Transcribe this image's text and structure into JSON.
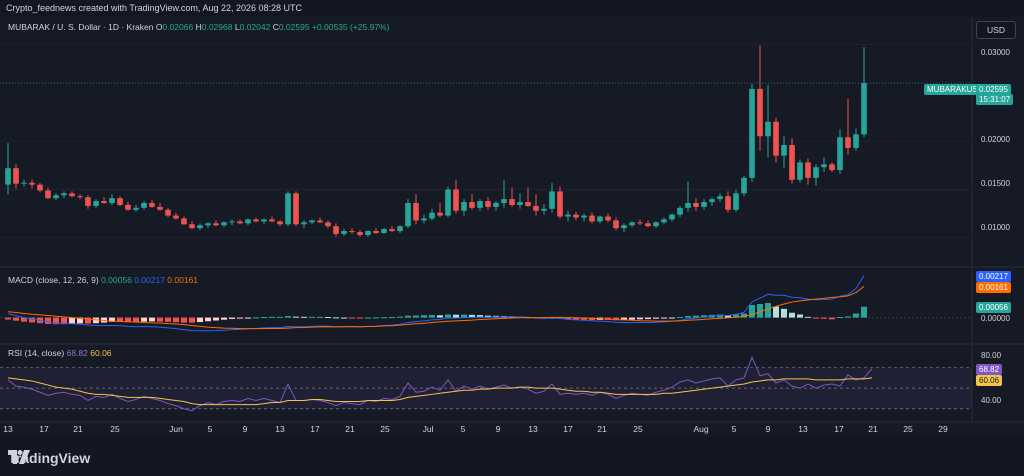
{
  "header": {
    "caption": "Crypto_feednews created with TradingView.com, Aug 22, 2026 08:28 UTC"
  },
  "symbol": {
    "title": "MUBARAK / U. S. Dollar · 1D · Kraken",
    "o_label": "O",
    "o": "0.02066",
    "h_label": "H",
    "h": "0.02968",
    "l_label": "L",
    "l": "0.02042",
    "c_label": "C",
    "c": "0.02595",
    "change": "+0.00535 (+25.97%)"
  },
  "currency_button": "USD",
  "price_axis": [
    "0.03000",
    "0.02000",
    "0.01500",
    "0.01000"
  ],
  "last_price": {
    "ticker": "MUBARAKUSD",
    "price": "0.02595",
    "countdown": "15:31:07"
  },
  "macd": {
    "title": "MACD (close, 12, 26, 9)",
    "hist": "0.00056",
    "macd": "0.00217",
    "signal": "0.00161",
    "zero": "0.00000"
  },
  "rsi": {
    "title": "RSI (14, close)",
    "rsi": "68.82",
    "ma": "60.06",
    "upper": "80.00",
    "lower": "40.00"
  },
  "time_axis": [
    "13",
    "17",
    "21",
    "25",
    "Jun",
    "5",
    "9",
    "13",
    "17",
    "21",
    "25",
    "Jul",
    "5",
    "9",
    "13",
    "17",
    "21",
    "25",
    "Aug",
    "5",
    "9",
    "13",
    "17",
    "21",
    "25",
    "29"
  ],
  "colors": {
    "up": "#26a69a",
    "down": "#ef5350",
    "macd": "#2962ff",
    "signal": "#ff6d00",
    "rsi": "#7e57c2",
    "rsi_ma": "#f3c44a"
  },
  "brand": "TradingView",
  "chart_data": {
    "type": "candlestick",
    "interval": "1D",
    "x_start": "2025-05-13",
    "price_ylim": [
      0.0075,
      0.0318
    ],
    "candles": [
      [
        0.0155,
        0.0198,
        0.0145,
        0.0172
      ],
      [
        0.0172,
        0.0176,
        0.0151,
        0.0156
      ],
      [
        0.0156,
        0.016,
        0.0153,
        0.0157
      ],
      [
        0.0157,
        0.016,
        0.0151,
        0.0155
      ],
      [
        0.0155,
        0.0157,
        0.0147,
        0.0149
      ],
      [
        0.0149,
        0.0152,
        0.014,
        0.0141
      ],
      [
        0.0141,
        0.0146,
        0.0139,
        0.0144
      ],
      [
        0.0144,
        0.0148,
        0.0141,
        0.0146
      ],
      [
        0.0146,
        0.0148,
        0.0142,
        0.0143
      ],
      [
        0.0143,
        0.0145,
        0.014,
        0.0142
      ],
      [
        0.0142,
        0.0144,
        0.013,
        0.0133
      ],
      [
        0.0133,
        0.014,
        0.0131,
        0.0138
      ],
      [
        0.0138,
        0.0142,
        0.0135,
        0.0136
      ],
      [
        0.0136,
        0.0145,
        0.0134,
        0.0141
      ],
      [
        0.0141,
        0.0143,
        0.0133,
        0.0134
      ],
      [
        0.0134,
        0.0137,
        0.0128,
        0.0129
      ],
      [
        0.0129,
        0.0134,
        0.0127,
        0.0131
      ],
      [
        0.0131,
        0.0138,
        0.0129,
        0.0136
      ],
      [
        0.0136,
        0.0139,
        0.0131,
        0.0132
      ],
      [
        0.0132,
        0.0136,
        0.0128,
        0.0129
      ],
      [
        0.0129,
        0.0131,
        0.0121,
        0.0123
      ],
      [
        0.0123,
        0.0126,
        0.0119,
        0.012
      ],
      [
        0.012,
        0.0122,
        0.0113,
        0.0114
      ],
      [
        0.0114,
        0.0117,
        0.0109,
        0.011
      ],
      [
        0.011,
        0.0115,
        0.0108,
        0.0113
      ],
      [
        0.0113,
        0.0116,
        0.011,
        0.0115
      ],
      [
        0.0115,
        0.0118,
        0.0112,
        0.0113
      ],
      [
        0.0113,
        0.0117,
        0.0111,
        0.0116
      ],
      [
        0.0116,
        0.0119,
        0.0113,
        0.0117
      ],
      [
        0.0117,
        0.0119,
        0.0114,
        0.0115
      ],
      [
        0.0115,
        0.012,
        0.0113,
        0.0119
      ],
      [
        0.0119,
        0.0121,
        0.0116,
        0.0117
      ],
      [
        0.0117,
        0.012,
        0.0114,
        0.0119
      ],
      [
        0.0119,
        0.0122,
        0.0116,
        0.0117
      ],
      [
        0.0117,
        0.0118,
        0.0112,
        0.0114
      ],
      [
        0.0114,
        0.0148,
        0.0112,
        0.0146
      ],
      [
        0.0146,
        0.0148,
        0.0112,
        0.0114
      ],
      [
        0.0114,
        0.0118,
        0.011,
        0.0116
      ],
      [
        0.0116,
        0.0119,
        0.0114,
        0.0118
      ],
      [
        0.0118,
        0.0121,
        0.0115,
        0.0116
      ],
      [
        0.0116,
        0.0118,
        0.011,
        0.0112
      ],
      [
        0.0112,
        0.0115,
        0.0101,
        0.0104
      ],
      [
        0.0104,
        0.0109,
        0.0102,
        0.0107
      ],
      [
        0.0107,
        0.011,
        0.0104,
        0.0106
      ],
      [
        0.0106,
        0.0108,
        0.0101,
        0.0103
      ],
      [
        0.0103,
        0.0108,
        0.0101,
        0.0107
      ],
      [
        0.0107,
        0.011,
        0.0104,
        0.0105
      ],
      [
        0.0105,
        0.011,
        0.0104,
        0.0109
      ],
      [
        0.0109,
        0.0112,
        0.0106,
        0.0107
      ],
      [
        0.0107,
        0.0113,
        0.0105,
        0.0112
      ],
      [
        0.0112,
        0.014,
        0.011,
        0.0136
      ],
      [
        0.0136,
        0.0145,
        0.0114,
        0.0118
      ],
      [
        0.0118,
        0.0124,
        0.0115,
        0.012
      ],
      [
        0.012,
        0.013,
        0.0118,
        0.0126
      ],
      [
        0.0126,
        0.0136,
        0.0121,
        0.0123
      ],
      [
        0.0123,
        0.0153,
        0.0121,
        0.015
      ],
      [
        0.015,
        0.016,
        0.0125,
        0.0128
      ],
      [
        0.0128,
        0.014,
        0.0123,
        0.0137
      ],
      [
        0.0137,
        0.0145,
        0.0129,
        0.0131
      ],
      [
        0.0131,
        0.014,
        0.0128,
        0.0138
      ],
      [
        0.0138,
        0.0142,
        0.0129,
        0.0132
      ],
      [
        0.0132,
        0.0138,
        0.0128,
        0.0136
      ],
      [
        0.0136,
        0.016,
        0.0131,
        0.014
      ],
      [
        0.014,
        0.0152,
        0.0132,
        0.0134
      ],
      [
        0.0134,
        0.0146,
        0.013,
        0.0137
      ],
      [
        0.0137,
        0.0152,
        0.0132,
        0.0133
      ],
      [
        0.0133,
        0.0145,
        0.0123,
        0.0128
      ],
      [
        0.0128,
        0.0135,
        0.0124,
        0.013
      ],
      [
        0.013,
        0.0157,
        0.0126,
        0.0148
      ],
      [
        0.0148,
        0.0153,
        0.012,
        0.0122
      ],
      [
        0.0122,
        0.0128,
        0.0117,
        0.0124
      ],
      [
        0.0124,
        0.0127,
        0.0118,
        0.0121
      ],
      [
        0.0121,
        0.0125,
        0.0117,
        0.0123
      ],
      [
        0.0123,
        0.0126,
        0.0115,
        0.0117
      ],
      [
        0.0117,
        0.0123,
        0.0115,
        0.0122
      ],
      [
        0.0122,
        0.0125,
        0.0116,
        0.0118
      ],
      [
        0.0118,
        0.0121,
        0.0108,
        0.011
      ],
      [
        0.011,
        0.0115,
        0.0106,
        0.0113
      ],
      [
        0.0113,
        0.0117,
        0.0111,
        0.0116
      ],
      [
        0.0116,
        0.0119,
        0.0113,
        0.0115
      ],
      [
        0.0115,
        0.0118,
        0.0111,
        0.0112
      ],
      [
        0.0112,
        0.0117,
        0.011,
        0.0116
      ],
      [
        0.0116,
        0.0121,
        0.0114,
        0.0119
      ],
      [
        0.0119,
        0.0125,
        0.0117,
        0.0124
      ],
      [
        0.0124,
        0.0133,
        0.0121,
        0.0131
      ],
      [
        0.0131,
        0.0158,
        0.0127,
        0.0136
      ],
      [
        0.0136,
        0.0141,
        0.0128,
        0.0132
      ],
      [
        0.0132,
        0.014,
        0.0129,
        0.0137
      ],
      [
        0.0137,
        0.0142,
        0.0133,
        0.014
      ],
      [
        0.014,
        0.0146,
        0.0137,
        0.0143
      ],
      [
        0.0143,
        0.0148,
        0.0126,
        0.0129
      ],
      [
        0.0129,
        0.015,
        0.0127,
        0.0146
      ],
      [
        0.0146,
        0.0164,
        0.0143,
        0.0162
      ],
      [
        0.0162,
        0.0259,
        0.0158,
        0.0254
      ],
      [
        0.0254,
        0.0299,
        0.019,
        0.0205
      ],
      [
        0.0205,
        0.0258,
        0.0183,
        0.022
      ],
      [
        0.022,
        0.0224,
        0.0178,
        0.0185
      ],
      [
        0.0185,
        0.0205,
        0.0172,
        0.0196
      ],
      [
        0.0196,
        0.0203,
        0.0156,
        0.016
      ],
      [
        0.016,
        0.0181,
        0.0157,
        0.0178
      ],
      [
        0.0178,
        0.0182,
        0.0155,
        0.0162
      ],
      [
        0.0162,
        0.0176,
        0.0154,
        0.0173
      ],
      [
        0.0173,
        0.0183,
        0.0168,
        0.0176
      ],
      [
        0.0176,
        0.0178,
        0.0168,
        0.017
      ],
      [
        0.017,
        0.0212,
        0.0166,
        0.0204
      ],
      [
        0.0204,
        0.0244,
        0.0186,
        0.0193
      ],
      [
        0.0193,
        0.0213,
        0.019,
        0.0207
      ],
      [
        0.0207,
        0.0297,
        0.0204,
        0.026
      ]
    ],
    "macd_ylim": [
      -0.001,
      0.0024
    ],
    "macd_hist": [
      -0.0001,
      -0.00016,
      -0.00021,
      -0.00025,
      -0.00029,
      -0.00033,
      -0.00034,
      -0.00034,
      -0.00032,
      -0.0003,
      -0.00031,
      -0.00029,
      -0.00026,
      -0.00022,
      -0.00022,
      -0.00024,
      -0.00024,
      -0.00021,
      -0.0002,
      -0.00021,
      -0.00022,
      -0.00024,
      -0.00026,
      -0.00026,
      -0.00023,
      -0.00019,
      -0.00015,
      -0.00011,
      -7e-05,
      -4e-05,
      -1e-05,
      1e-05,
      3e-05,
      4e-05,
      4e-05,
      8e-05,
      5e-05,
      4e-05,
      4e-05,
      4e-05,
      3e-05,
      1e-05,
      0.0,
      -1e-05,
      -1e-05,
      0.0,
      1e-05,
      2e-05,
      3e-05,
      5e-05,
      0.0001,
      0.00011,
      0.00012,
      0.00013,
      0.00012,
      0.00016,
      0.00015,
      0.00015,
      0.00014,
      0.00013,
      0.0001,
      9e-05,
      8e-05,
      6e-05,
      4e-05,
      2e-05,
      -2e-05,
      -5e-05,
      -2e-05,
      -6e-05,
      -9e-05,
      -0.00011,
      -0.00012,
      -0.00013,
      -0.00012,
      -0.00012,
      -0.00014,
      -0.00013,
      -0.00011,
      -9e-05,
      -8e-05,
      -6e-05,
      -4e-05,
      -1e-05,
      3e-05,
      8e-05,
      0.0001,
      0.00012,
      0.00014,
      0.00016,
      0.00012,
      0.00015,
      0.00021,
      0.00065,
      0.0007,
      0.00075,
      0.00057,
      0.00045,
      0.00025,
      0.00016,
      4e-05,
      -3e-05,
      -6e-05,
      -9e-05,
      3e-05,
      6e-05,
      0.00021,
      0.00056
    ],
    "macd_line": [
      0.0002,
      0.0001,
      0.0,
      -8e-05,
      -0.00015,
      -0.00022,
      -0.00027,
      -0.0003,
      -0.00032,
      -0.00034,
      -0.00038,
      -0.0004,
      -0.00041,
      -0.00041,
      -0.00042,
      -0.00045,
      -0.00047,
      -0.00046,
      -0.00047,
      -0.00049,
      -0.00053,
      -0.00057,
      -0.00062,
      -0.00067,
      -0.00068,
      -0.00068,
      -0.00067,
      -0.00065,
      -0.00062,
      -0.00061,
      -0.00058,
      -0.00056,
      -0.00053,
      -0.00052,
      -0.00052,
      -0.00046,
      -0.00047,
      -0.00047,
      -0.00045,
      -0.00044,
      -0.00044,
      -0.00047,
      -0.00047,
      -0.00047,
      -0.00048,
      -0.00046,
      -0.00044,
      -0.00041,
      -0.00039,
      -0.00034,
      -0.00025,
      -0.00021,
      -0.00017,
      -0.00012,
      -0.0001,
      -3e-05,
      -2e-05,
      0.0,
      1e-05,
      3e-05,
      2e-05,
      3e-05,
      4e-05,
      4e-05,
      3e-05,
      2e-05,
      -2e-05,
      -5e-05,
      -1e-05,
      -5e-05,
      -9e-05,
      -0.00012,
      -0.00014,
      -0.00017,
      -0.00018,
      -0.0002,
      -0.00024,
      -0.00025,
      -0.00025,
      -0.00025,
      -0.00025,
      -0.00024,
      -0.00022,
      -0.00019,
      -0.00014,
      -6e-05,
      -2e-05,
      3e-05,
      8e-05,
      0.00012,
      0.00011,
      0.00017,
      0.00027,
      0.0008,
      0.001,
      0.0012,
      0.00115,
      0.00115,
      0.00105,
      0.00102,
      0.00095,
      0.00092,
      0.00093,
      0.00095,
      0.0011,
      0.00118,
      0.0015,
      0.00217
    ],
    "macd_signal": [
      0.0003,
      0.00026,
      0.00021,
      0.00017,
      0.00014,
      0.00011,
      7e-05,
      4e-05,
      0.0,
      -4e-05,
      -7e-05,
      -0.00011,
      -0.00015,
      -0.00019,
      -0.0002,
      -0.00021,
      -0.00023,
      -0.00025,
      -0.00027,
      -0.00028,
      -0.00031,
      -0.00033,
      -0.00036,
      -0.00041,
      -0.00045,
      -0.00049,
      -0.00052,
      -0.00054,
      -0.00055,
      -0.00057,
      -0.00057,
      -0.00057,
      -0.00056,
      -0.00056,
      -0.00056,
      -0.00054,
      -0.00052,
      -0.00051,
      -0.00049,
      -0.00048,
      -0.00047,
      -0.00048,
      -0.00047,
      -0.00046,
      -0.00047,
      -0.00046,
      -0.00045,
      -0.00043,
      -0.00042,
      -0.00039,
      -0.00035,
      -0.00032,
      -0.00029,
      -0.00025,
      -0.00022,
      -0.00019,
      -0.00017,
      -0.00015,
      -0.00013,
      -0.0001,
      -8e-05,
      -6e-05,
      -4e-05,
      -2e-05,
      -1e-05,
      0.0,
      0.0,
      0.0,
      1e-05,
      1e-05,
      0.0,
      -1e-05,
      -2e-05,
      -4e-05,
      -6e-05,
      -8e-05,
      -0.0001,
      -0.00012,
      -0.00014,
      -0.00016,
      -0.00017,
      -0.00018,
      -0.00018,
      -0.00018,
      -0.00017,
      -0.00014,
      -0.00012,
      -9e-05,
      -6e-05,
      -4e-05,
      -1e-05,
      2e-05,
      6e-05,
      0.00015,
      0.0003,
      0.00045,
      0.00058,
      0.0007,
      0.0008,
      0.00086,
      0.00091,
      0.00095,
      0.00099,
      0.00104,
      0.00107,
      0.00112,
      0.00129,
      0.00161
    ],
    "rsi_ylim": [
      20,
      90
    ],
    "rsi_bands": [
      70,
      50,
      30
    ],
    "rsi": [
      58,
      52,
      51,
      49,
      46,
      43,
      45,
      46,
      44,
      43,
      38,
      42,
      41,
      44,
      40,
      37,
      39,
      42,
      40,
      38,
      35,
      33,
      30,
      28,
      33,
      36,
      34,
      37,
      38,
      37,
      40,
      38,
      40,
      38,
      36,
      54,
      38,
      38,
      39,
      38,
      36,
      33,
      36,
      35,
      34,
      38,
      37,
      40,
      39,
      42,
      55,
      46,
      47,
      51,
      48,
      58,
      47,
      52,
      49,
      52,
      49,
      51,
      53,
      50,
      51,
      49,
      45,
      47,
      54,
      44,
      45,
      44,
      45,
      43,
      46,
      44,
      40,
      43,
      45,
      44,
      43,
      46,
      48,
      51,
      56,
      58,
      55,
      57,
      59,
      60,
      52,
      58,
      60,
      80,
      62,
      64,
      55,
      58,
      52,
      50,
      54,
      50,
      53,
      54,
      52,
      63,
      58,
      60,
      69
    ],
    "rsi_ma": [
      60,
      59,
      58,
      57,
      55,
      53,
      51,
      50,
      49,
      47,
      45,
      44,
      44,
      43,
      42,
      41,
      41,
      41,
      41,
      40,
      39,
      38,
      37,
      35,
      34,
      34,
      34,
      34,
      34,
      34,
      34,
      34,
      35,
      36,
      36,
      38,
      38,
      38,
      39,
      39,
      38,
      37,
      37,
      37,
      37,
      38,
      38,
      38,
      38,
      39,
      41,
      42,
      43,
      44,
      45,
      46,
      47,
      48,
      48,
      49,
      49,
      50,
      50,
      50,
      51,
      51,
      50,
      50,
      50,
      49,
      48,
      47,
      47,
      46,
      46,
      45,
      44,
      44,
      44,
      44,
      44,
      44,
      45,
      45,
      46,
      47,
      48,
      49,
      50,
      51,
      52,
      53,
      54,
      56,
      57,
      58,
      58,
      59,
      59,
      59,
      59,
      58,
      58,
      58,
      58,
      59,
      59,
      59,
      60
    ]
  }
}
